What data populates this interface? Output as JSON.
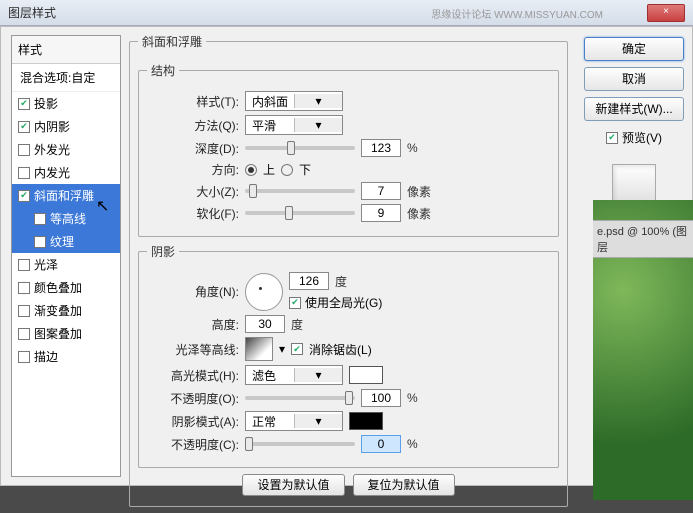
{
  "window": {
    "title": "图层样式",
    "close": "×",
    "watermark": "思缘设计论坛  WWW.MISSYUAN.COM"
  },
  "sidebar": {
    "header": "样式",
    "blending": "混合选项:自定",
    "items": [
      {
        "label": "投影",
        "checked": true
      },
      {
        "label": "内阴影",
        "checked": true
      },
      {
        "label": "外发光",
        "checked": false
      },
      {
        "label": "内发光",
        "checked": false
      },
      {
        "label": "斜面和浮雕",
        "checked": true,
        "selected": true
      },
      {
        "label": "等高线",
        "checked": false,
        "sub": true,
        "selected": true
      },
      {
        "label": "纹理",
        "checked": false,
        "sub": true,
        "selected": true
      },
      {
        "label": "光泽",
        "checked": false
      },
      {
        "label": "颜色叠加",
        "checked": false
      },
      {
        "label": "渐变叠加",
        "checked": false
      },
      {
        "label": "图案叠加",
        "checked": false
      },
      {
        "label": "描边",
        "checked": false
      }
    ]
  },
  "panel": {
    "title": "斜面和浮雕",
    "structure": {
      "legend": "结构",
      "style_lbl": "样式(T):",
      "style_val": "内斜面",
      "tech_lbl": "方法(Q):",
      "tech_val": "平滑",
      "depth_lbl": "深度(D):",
      "depth_val": "123",
      "depth_unit": "%",
      "dir_lbl": "方向:",
      "dir_up": "上",
      "dir_down": "下",
      "size_lbl": "大小(Z):",
      "size_val": "7",
      "size_unit": "像素",
      "soft_lbl": "软化(F):",
      "soft_val": "9",
      "soft_unit": "像素"
    },
    "shading": {
      "legend": "阴影",
      "angle_lbl": "角度(N):",
      "angle_val": "126",
      "angle_unit": "度",
      "global_lbl": "使用全局光(G)",
      "alt_lbl": "高度:",
      "alt_val": "30",
      "alt_unit": "度",
      "gloss_lbl": "光泽等高线:",
      "aa_lbl": "消除锯齿(L)",
      "hmode_lbl": "高光模式(H):",
      "hmode_val": "滤色",
      "hcolor": "#ffffff",
      "hop_lbl": "不透明度(O):",
      "hop_val": "100",
      "hop_unit": "%",
      "smode_lbl": "阴影模式(A):",
      "smode_val": "正常",
      "scolor": "#000000",
      "sop_lbl": "不透明度(C):",
      "sop_val": "0",
      "sop_unit": "%"
    },
    "defaults_btn": "设置为默认值",
    "reset_btn": "复位为默认值"
  },
  "right": {
    "ok": "确定",
    "cancel": "取消",
    "newstyle": "新建样式(W)...",
    "preview_lbl": "预览(V)"
  },
  "tab": "e.psd @ 100% (图层"
}
